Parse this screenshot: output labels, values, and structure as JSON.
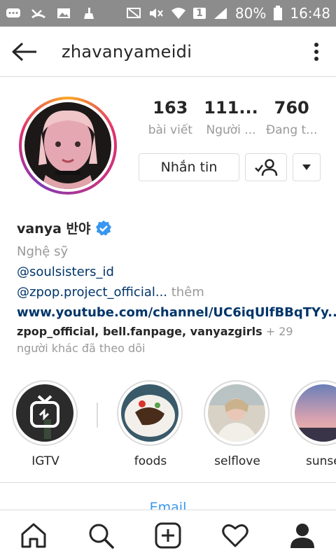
{
  "status_bar": {
    "battery": "80%",
    "time": "16:48",
    "sim": "1"
  },
  "header": {
    "username": "zhavanyameidi"
  },
  "stats": [
    {
      "value": "163",
      "label": "bài viết"
    },
    {
      "value": "111...",
      "label": "Người ..."
    },
    {
      "value": "760",
      "label": "Đang t..."
    }
  ],
  "actions": {
    "message_label": "Nhắn tin"
  },
  "bio": {
    "name": "vanya 반야",
    "category": "Nghệ sỹ",
    "lines": [
      "@soulsisters_id",
      "@zpop.project_official...",
      "www.youtube.com/channel/UC6iqUlfBBqTYy..."
    ],
    "more_label": "thêm"
  },
  "followed_by": {
    "accounts": "zpop_official, bell.fanpage, vanyazgirls",
    "rest": "+ 29 người khác đã theo dõi"
  },
  "highlights": [
    {
      "label": "IGTV"
    },
    {
      "label": "foods"
    },
    {
      "label": "selflove"
    },
    {
      "label": "sunse"
    }
  ],
  "contact": {
    "email_label": "Email"
  },
  "colors": {
    "accent": "#3897f0",
    "link": "#003569",
    "muted": "#999999"
  }
}
